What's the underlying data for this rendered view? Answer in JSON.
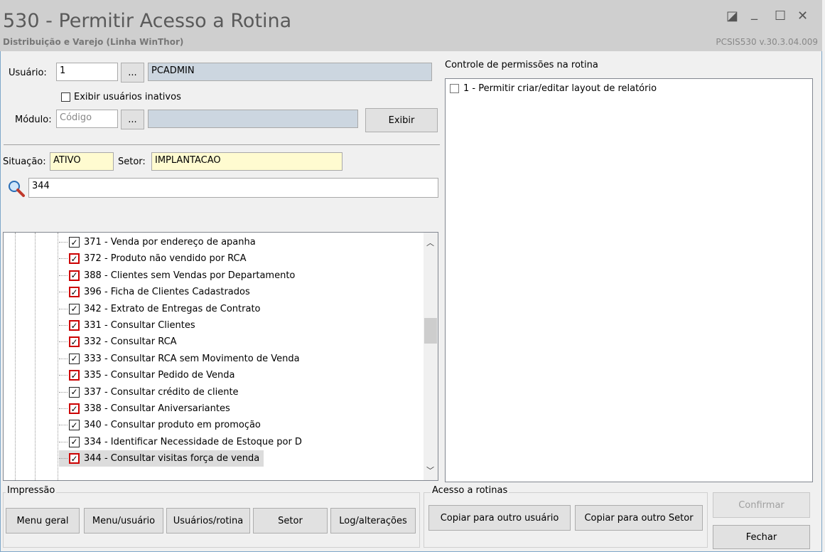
{
  "window": {
    "title": "530 - Permitir Acesso a Rotina",
    "subtitle": "Distribuição e Varejo (Linha WinThor)",
    "version": "PCSIS530  v.30.3.04.009",
    "restore_glyph": "◪",
    "minimize_glyph": "_",
    "maximize_glyph": "☐",
    "close_glyph": "✕"
  },
  "form": {
    "usuario_label": "Usuário:",
    "usuario_code": "1",
    "usuario_name": "PCADMIN",
    "browse_label": "...",
    "inativos_label": "Exibir usuários inativos",
    "modulo_label": "Módulo:",
    "modulo_placeholder": "Código",
    "exibir_label": "Exibir",
    "situacao_label": "Situação:",
    "situacao_value": "ATIVO",
    "setor_label": "Setor:",
    "setor_value": "IMPLANTACAO",
    "search_value": "344"
  },
  "tree": {
    "items": [
      {
        "label": "371 - Venda por endereço de apanha",
        "red": false
      },
      {
        "label": "372 - Produto não vendido por RCA",
        "red": true
      },
      {
        "label": "388 - Clientes sem Vendas por Departamento",
        "red": true
      },
      {
        "label": "396 - Ficha de Clientes Cadastrados",
        "red": true
      },
      {
        "label": "342 - Extrato de Entregas de Contrato",
        "red": false
      },
      {
        "label": "331 - Consultar Clientes",
        "red": true
      },
      {
        "label": "332 - Consultar RCA",
        "red": true
      },
      {
        "label": "333 - Consultar RCA sem Movimento de Venda",
        "red": false
      },
      {
        "label": "335 - Consultar Pedido de Venda",
        "red": true
      },
      {
        "label": "337 - Consultar crédito de cliente",
        "red": false
      },
      {
        "label": "338 - Consultar Aniversariantes",
        "red": true
      },
      {
        "label": "340 - Consultar produto em promoção",
        "red": false
      },
      {
        "label": "334 - Identificar Necessidade de Estoque por D",
        "red": false
      },
      {
        "label": "344 - Consultar visitas força de venda",
        "red": true
      }
    ],
    "check_glyph": "✓"
  },
  "permissions": {
    "title": "Controle de permissões na rotina",
    "items": [
      "1 - Permitir criar/editar layout de relatório"
    ]
  },
  "impressao": {
    "title": "Impressão",
    "buttons": [
      "Menu geral",
      "Menu/usuário",
      "Usuários/rotina",
      "Setor",
      "Log/alterações"
    ]
  },
  "acesso": {
    "title": "Acesso a rotinas",
    "buttons": [
      "Copiar para outro usuário",
      "Copiar para outro Setor"
    ]
  },
  "actions": {
    "confirmar": "Confirmar",
    "fechar": "Fechar"
  }
}
